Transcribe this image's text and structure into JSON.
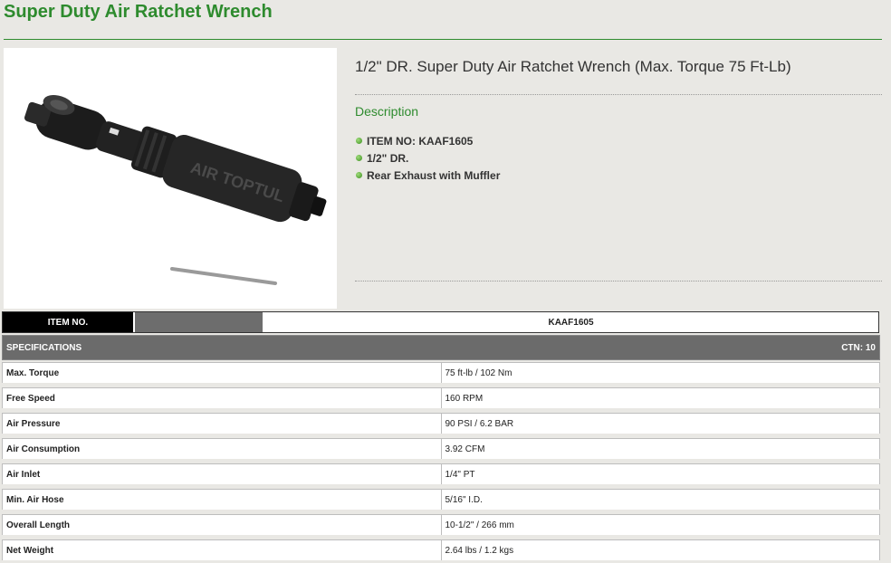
{
  "page": {
    "title": "Super Duty Air Ratchet Wrench"
  },
  "product": {
    "heading": "1/2\" DR. Super Duty Air Ratchet Wrench (Max. Torque 75 Ft-Lb)",
    "description_title": "Description",
    "bullets": [
      "ITEM NO: KAAF1605",
      "1/2\" DR.",
      "Rear Exhaust with Muffler"
    ],
    "image_brand_text": "AIR TOPTUL"
  },
  "item_bar": {
    "label": "ITEM NO.",
    "value": "KAAF1605"
  },
  "specifications": {
    "title": "SPECIFICATIONS",
    "ctn": "CTN: 10",
    "rows": [
      {
        "name": "Max. Torque",
        "value": "75 ft-lb / 102 Nm"
      },
      {
        "name": "Free Speed",
        "value": "160 RPM"
      },
      {
        "name": "Air Pressure",
        "value": "90 PSI / 6.2 BAR"
      },
      {
        "name": "Air Consumption",
        "value": "3.92 CFM"
      },
      {
        "name": "Air Inlet",
        "value": "1/4\" PT"
      },
      {
        "name": "Min. Air Hose",
        "value": "5/16\" I.D."
      },
      {
        "name": "Overall Length",
        "value": "10-1/2\" / 266 mm"
      },
      {
        "name": "Net Weight",
        "value": "2.64 lbs / 1.2 kgs"
      }
    ]
  },
  "colors": {
    "accent_green": "#2e8b2e",
    "background": "#e9e8e4",
    "header_gray": "#6b6b6b"
  }
}
